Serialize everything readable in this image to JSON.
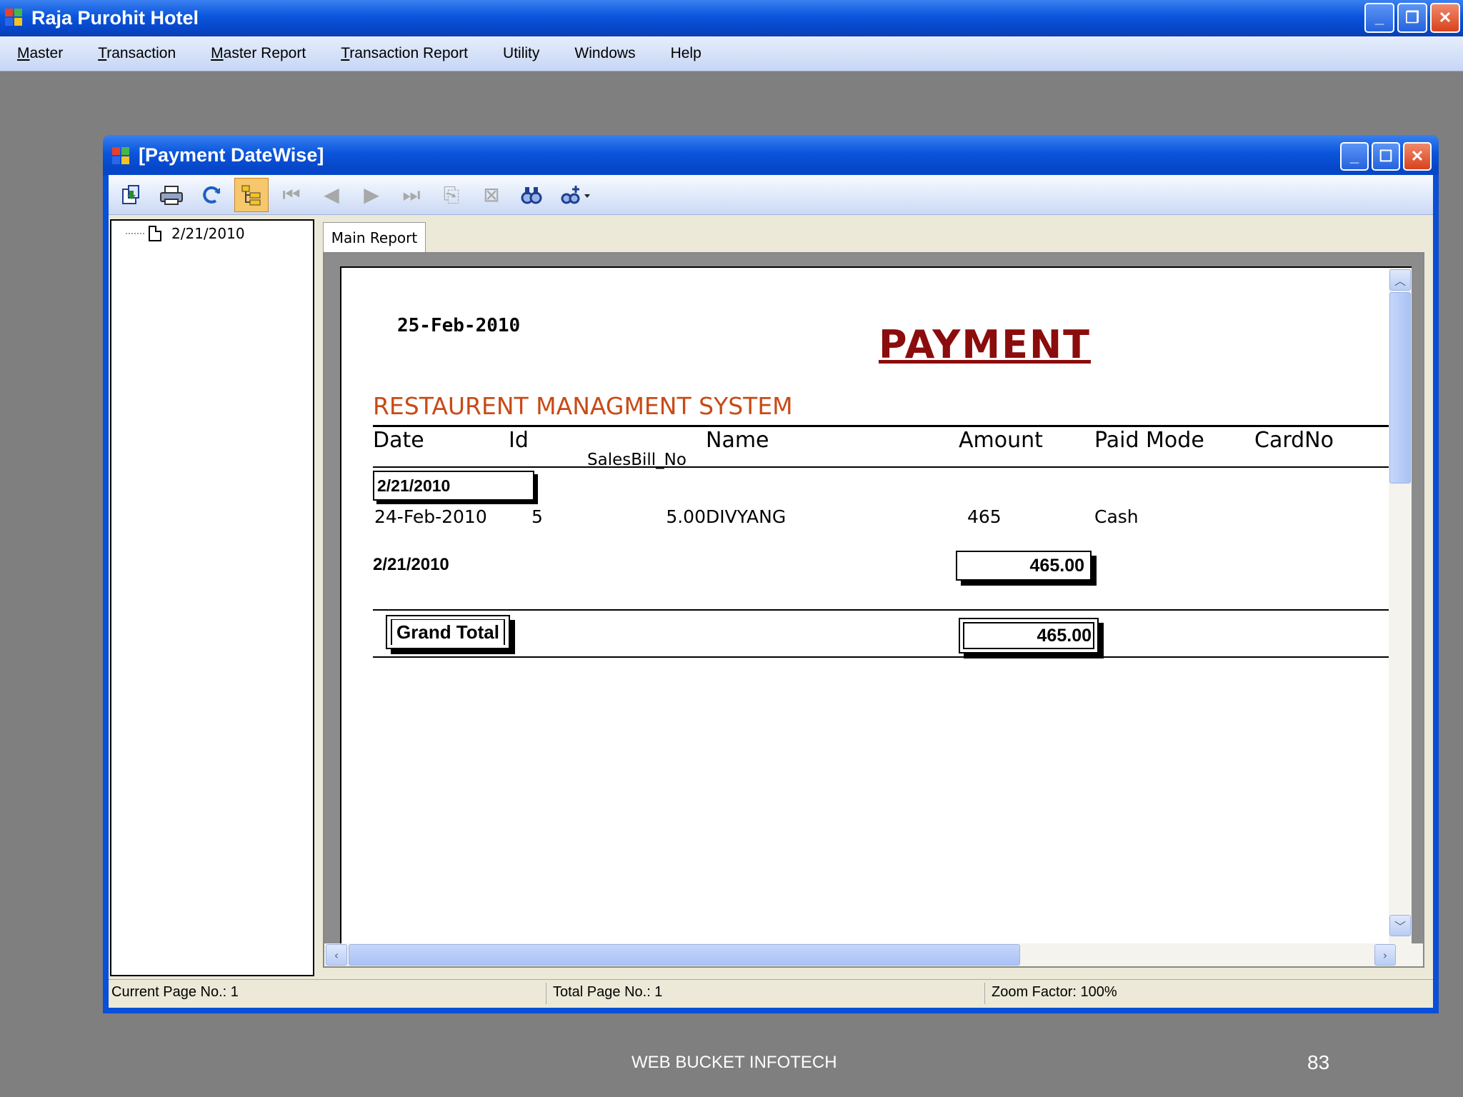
{
  "app": {
    "title": "Raja Purohit Hotel",
    "accent": "#0a55dc"
  },
  "menu": {
    "items": [
      {
        "first": "M",
        "rest": "aster"
      },
      {
        "first": "T",
        "rest": "ransaction"
      },
      {
        "first": "M",
        "rest": "aster Report"
      },
      {
        "first": "T",
        "rest": "ransaction Report"
      },
      {
        "first": "",
        "rest": "Utility"
      },
      {
        "first": "",
        "rest": "Windows"
      },
      {
        "first": "",
        "rest": "Help"
      }
    ]
  },
  "child_window": {
    "title": "[Payment DateWise]"
  },
  "toolbar": {
    "icons": [
      "export-icon",
      "print-icon",
      "refresh-icon",
      "group-tree-icon",
      "first-page-icon",
      "previous-page-icon",
      "next-page-icon",
      "last-page-icon",
      "goto-page-icon",
      "stop-icon",
      "search-icon",
      "zoom-icon"
    ]
  },
  "tree": {
    "item": "2/21/2010"
  },
  "tabs": {
    "main": "Main Report"
  },
  "report": {
    "print_date": "25-Feb-2010",
    "title": "PAYMENT",
    "subtitle": "RESTAURENT MANAGMENT SYSTEM",
    "title_color": "#8b0c0c",
    "subtitle_color": "#c84a16",
    "columns": {
      "date": "Date",
      "id": "Id",
      "sales_bill": "SalesBill_No",
      "name": "Name",
      "amount": "Amount",
      "paid_mode": "Paid Mode",
      "card_no": "CardNo"
    },
    "group_header": "2/21/2010",
    "rows": [
      {
        "date": "24-Feb-2010",
        "id": "5",
        "sales_bill": "5.00",
        "name": "DIVYANG",
        "amount": "465",
        "paid_mode": "Cash",
        "card_no": ""
      }
    ],
    "group_footer_label": "2/21/2010",
    "group_total": "465.00",
    "grand_total_label": "Grand Total",
    "grand_total": "465.00"
  },
  "status": {
    "current_page": "Current Page No.: 1",
    "total_page": "Total Page No.: 1",
    "zoom": "Zoom Factor: 100%"
  },
  "slide": {
    "footer": "WEB BUCKET INFOTECH",
    "page": "83"
  }
}
